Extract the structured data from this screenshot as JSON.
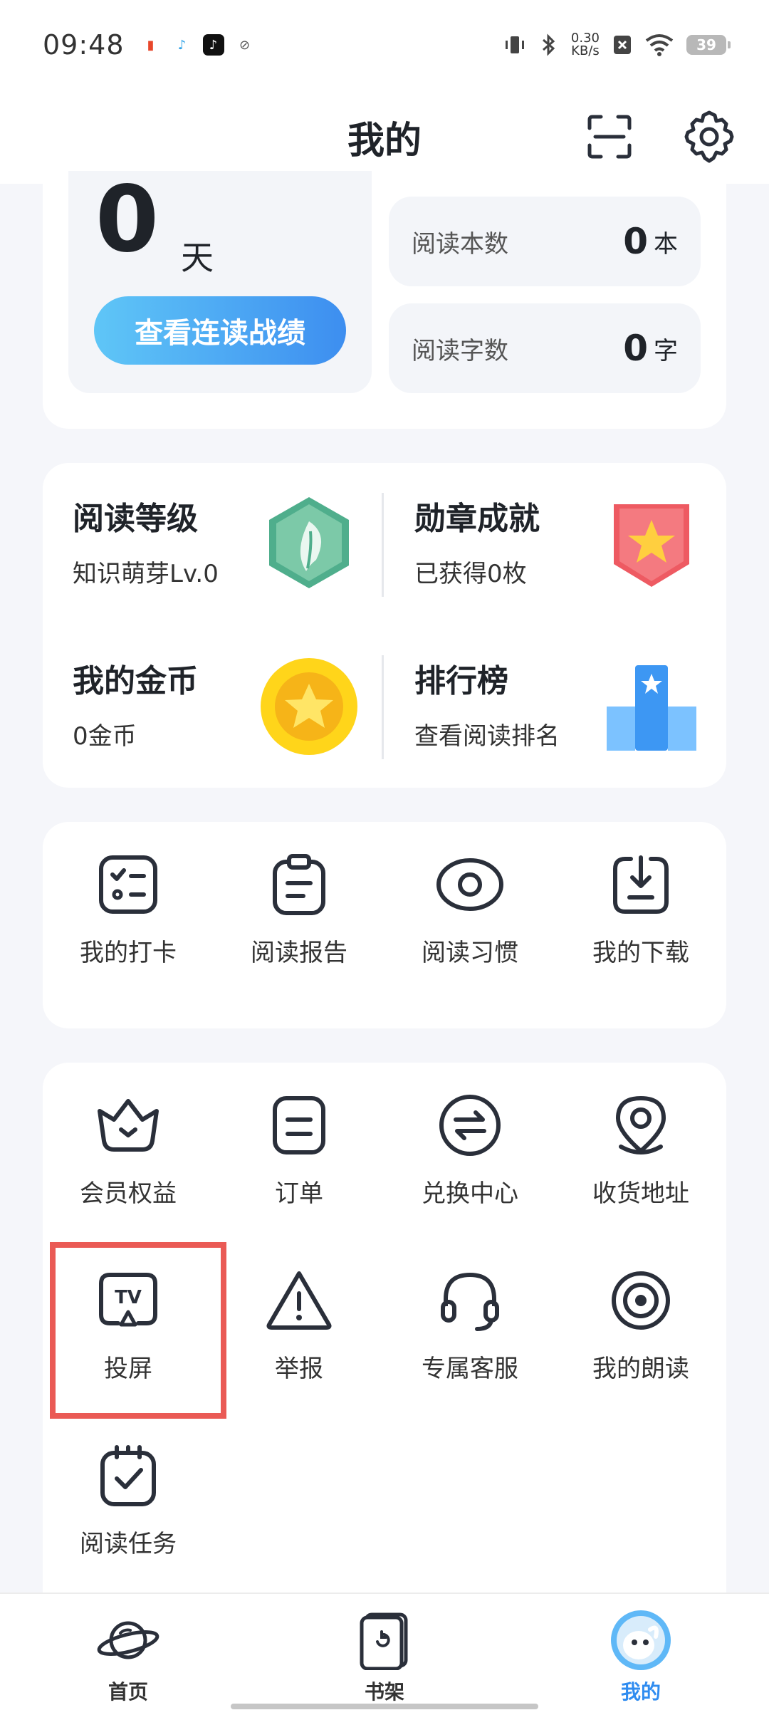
{
  "status": {
    "time": "09:48",
    "speed_value": "0.30",
    "speed_unit": "KB/s",
    "battery": "39"
  },
  "header": {
    "title": "我的"
  },
  "stats": {
    "streak_days": "0",
    "streak_unit": "天",
    "streak_button": "查看连读战绩",
    "books_label": "阅读本数",
    "books_value": "0",
    "books_unit": "本",
    "words_label": "阅读字数",
    "words_value": "0",
    "words_unit": "字"
  },
  "levels": {
    "reading_level_title": "阅读等级",
    "reading_level_sub": "知识萌芽Lv.0",
    "badges_title": "勋章成就",
    "badges_sub": "已获得0枚",
    "coins_title": "我的金币",
    "coins_sub": "0金币",
    "ranking_title": "排行榜",
    "ranking_sub": "查看阅读排名"
  },
  "tools": [
    {
      "label": "我的打卡",
      "icon": "checklist-icon"
    },
    {
      "label": "阅读报告",
      "icon": "clipboard-report-icon"
    },
    {
      "label": "阅读习惯",
      "icon": "eye-habit-icon"
    },
    {
      "label": "我的下载",
      "icon": "download-icon"
    }
  ],
  "services": [
    {
      "label": "会员权益",
      "icon": "crown-icon"
    },
    {
      "label": "订单",
      "icon": "order-icon"
    },
    {
      "label": "兑换中心",
      "icon": "exchange-icon"
    },
    {
      "label": "收货地址",
      "icon": "location-icon"
    },
    {
      "label": "投屏",
      "icon": "tv-cast-icon"
    },
    {
      "label": "举报",
      "icon": "warning-icon"
    },
    {
      "label": "专属客服",
      "icon": "headset-icon"
    },
    {
      "label": "我的朗读",
      "icon": "audio-read-icon"
    },
    {
      "label": "阅读任务",
      "icon": "task-calendar-icon"
    }
  ],
  "nav": {
    "home": "首页",
    "bookshelf": "书架",
    "mine": "我的"
  },
  "colors": {
    "accent": "#2f8cf0",
    "highlight": "#ea5a55"
  }
}
